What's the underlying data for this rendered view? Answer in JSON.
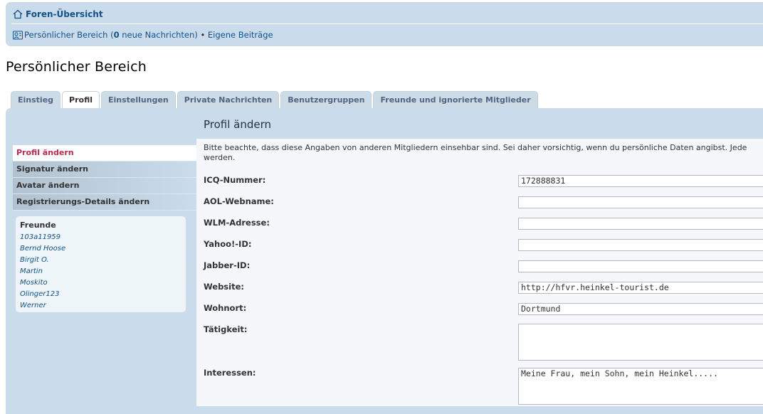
{
  "nav": {
    "forum_index": "Foren-Übersicht",
    "ucp_prefix": "Persönlicher Bereich (",
    "new_messages_count": "0",
    "ucp_suffix": " neue Nachrichten)",
    "separator": " • ",
    "own_posts": "Eigene Beiträge"
  },
  "page_title": "Persönlicher Bereich",
  "tabs": [
    {
      "label": "Einstieg"
    },
    {
      "label": "Profil"
    },
    {
      "label": "Einstellungen"
    },
    {
      "label": "Private Nachrichten"
    },
    {
      "label": "Benutzergruppen"
    },
    {
      "label": "Freunde und ignorierte Mitglieder"
    }
  ],
  "menu": [
    {
      "label": "Profil ändern"
    },
    {
      "label": "Signatur ändern"
    },
    {
      "label": "Avatar ändern"
    },
    {
      "label": "Registrierungs-Details ändern"
    }
  ],
  "friends": {
    "title": "Freunde",
    "names": [
      "103a11959",
      "Bernd Hoose",
      "Birgit O.",
      "Martin",
      "Moskito",
      "Olinger123",
      "Werner"
    ]
  },
  "content": {
    "heading": "Profil ändern",
    "intro_line1": "Bitte beachte, dass diese Angaben von anderen Mitgliedern einsehbar sind. Sei daher vorsichtig, wenn du persönliche Daten angibst. Jede",
    "intro_line2": "werden."
  },
  "fields": [
    {
      "label": "ICQ-Nummer:",
      "value": "172888831"
    },
    {
      "label": "AOL-Webname:",
      "value": ""
    },
    {
      "label": "WLM-Adresse:",
      "value": ""
    },
    {
      "label": "Yahoo!-ID:",
      "value": ""
    },
    {
      "label": "Jabber-ID:",
      "value": ""
    },
    {
      "label": "Website:",
      "value": "http://hfvr.heinkel-tourist.de"
    },
    {
      "label": "Wohnort:",
      "value": "Dortmund"
    },
    {
      "label": "Tätigkeit:",
      "value": ""
    },
    {
      "label": "Interessen:",
      "value": "Meine Frau, mein Sohn, mein Heinkel....."
    }
  ],
  "active_tab": "Profil",
  "active_menu": "Profil ändern",
  "colors": {
    "nav_bg": "#cadceb",
    "link": "#105289",
    "active_menu": "#bc2a4d"
  }
}
